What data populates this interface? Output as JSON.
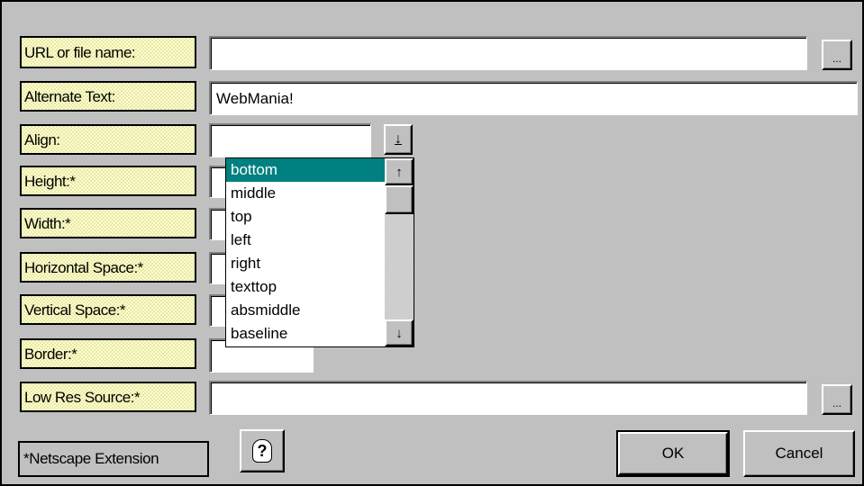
{
  "form": {
    "url_label": "URL or file name:",
    "url_value": "",
    "browse_label": "...",
    "alt_label": "Alternate Text:",
    "alt_value": "WebMania!",
    "align_label": "Align:",
    "align_value": "",
    "height_label": "Height:*",
    "width_label": "Width:*",
    "hspace_label": "Horizontal Space:*",
    "vspace_label": "Vertical Space:*",
    "border_label": "Border:*",
    "lowres_label": "Low Res Source:*",
    "lowres_value": "",
    "lowres_browse_label": "..."
  },
  "align_dropdown": {
    "options": [
      "bottom",
      "middle",
      "top",
      "left",
      "right",
      "texttop",
      "absmiddle",
      "baseline"
    ],
    "selected": "bottom",
    "arrow_down": "↓",
    "scroll_up": "↑",
    "scroll_down": "↓"
  },
  "footer": {
    "note": "*Netscape Extension",
    "help_glyph": "?",
    "ok_label": "OK",
    "cancel_label": "Cancel"
  },
  "colors": {
    "dialog_bg": "#c0c0c0",
    "label_bg": "#ffffd0",
    "selection": "#008080"
  }
}
